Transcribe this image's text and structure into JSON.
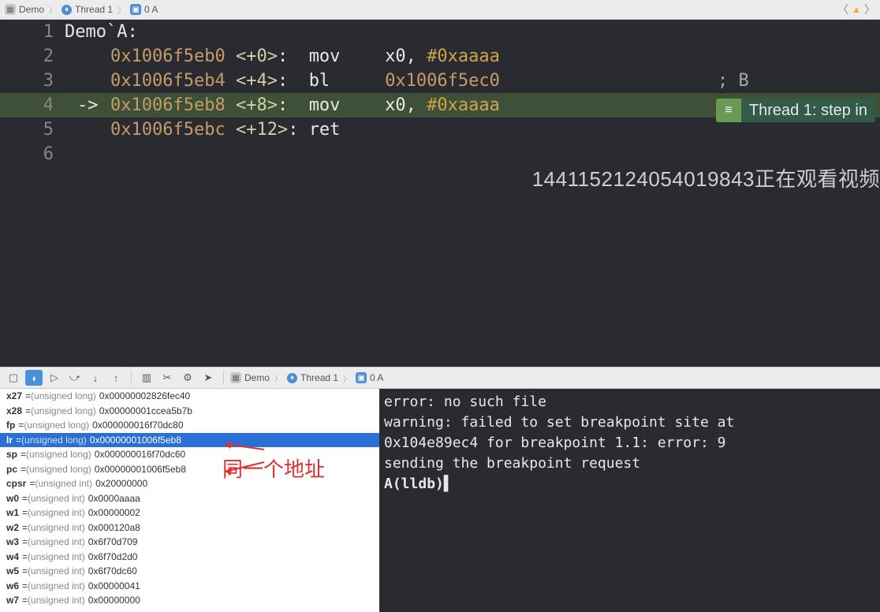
{
  "breadcrumb": {
    "demo": "Demo",
    "thread": "Thread 1",
    "frame": "0 A"
  },
  "code": {
    "func_label": "Demo`A:",
    "lines": [
      {
        "n": "1",
        "indent": false,
        "text": "Demo`A:"
      },
      {
        "n": "2",
        "indent": true,
        "arrow": "",
        "addr": "0x1006f5eb0",
        "off": "<+0>",
        "colon": ":",
        "op": "mov",
        "args_reg": "x0,",
        "args_hex": "#0xaaaa"
      },
      {
        "n": "3",
        "indent": true,
        "arrow": "",
        "addr": "0x1006f5eb4",
        "off": "<+4>",
        "colon": ":",
        "op": "bl",
        "args_addr": "0x1006f5ec0",
        "comment": "; B"
      },
      {
        "n": "4",
        "indent": true,
        "arrow": "->",
        "addr": "0x1006f5eb8",
        "off": "<+8>",
        "colon": ":",
        "op": "mov",
        "args_reg": "x0,",
        "args_hex": "#0xaaaa",
        "current": true
      },
      {
        "n": "5",
        "indent": true,
        "arrow": "",
        "addr": "0x1006f5ebc",
        "off": "<+12>",
        "colon": ":",
        "op": "ret"
      },
      {
        "n": "6",
        "indent": false,
        "text": ""
      }
    ]
  },
  "thread_pill": "Thread 1: step in",
  "watermark": "1441152124054019843正在观看视频",
  "dbg_breadcrumb": {
    "demo": "Demo",
    "thread": "Thread 1",
    "frame": "0 A"
  },
  "registers": [
    {
      "name": "x27",
      "type": "(unsigned long)",
      "val": "0x00000002826fec40"
    },
    {
      "name": "x28",
      "type": "(unsigned long)",
      "val": "0x00000001ccea5b7b"
    },
    {
      "name": "fp",
      "type": "(unsigned long)",
      "val": "0x000000016f70dc80"
    },
    {
      "name": "lr",
      "type": "(unsigned long)",
      "val": "0x00000001006f5eb8",
      "selected": true
    },
    {
      "name": "sp",
      "type": "(unsigned long)",
      "val": "0x000000016f70dc60"
    },
    {
      "name": "pc",
      "type": "(unsigned long)",
      "val": "0x00000001006f5eb8"
    },
    {
      "name": "cpsr",
      "type": "(unsigned int)",
      "val": "0x20000000"
    },
    {
      "name": "w0",
      "type": "(unsigned int)",
      "val": "0x0000aaaa"
    },
    {
      "name": "w1",
      "type": "(unsigned int)",
      "val": "0x00000002"
    },
    {
      "name": "w2",
      "type": "(unsigned int)",
      "val": "0x000120a8"
    },
    {
      "name": "w3",
      "type": "(unsigned int)",
      "val": "0x6f70d709"
    },
    {
      "name": "w4",
      "type": "(unsigned int)",
      "val": "0x6f70d2d0"
    },
    {
      "name": "w5",
      "type": "(unsigned int)",
      "val": "0x6f70dc60"
    },
    {
      "name": "w6",
      "type": "(unsigned int)",
      "val": "0x00000041"
    },
    {
      "name": "w7",
      "type": "(unsigned int)",
      "val": "0x00000000"
    }
  ],
  "annotation": "同一个地址",
  "console": {
    "l1": "error: no such file",
    "l2": "warning: failed to set breakpoint site at",
    "l3": "   0x104e89ec4 for breakpoint 1.1: error: 9",
    "l4": "   sending the breakpoint request",
    "l5a": "A",
    "l5b": "(lldb)"
  }
}
